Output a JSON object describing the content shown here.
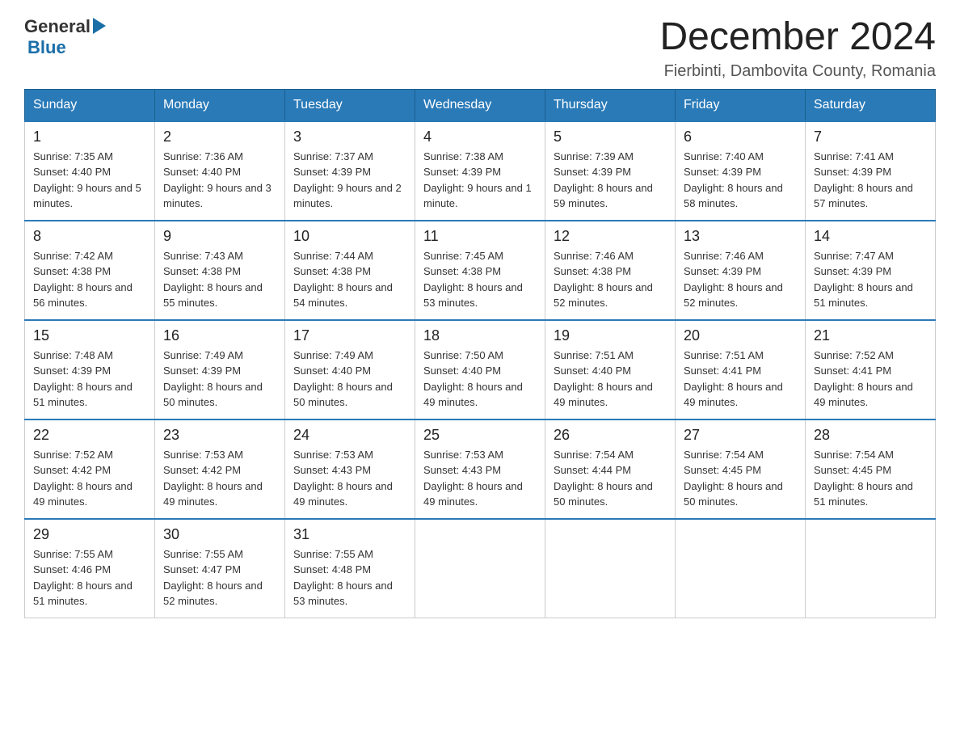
{
  "header": {
    "logo_general": "General",
    "logo_blue": "Blue",
    "month_year": "December 2024",
    "location": "Fierbinti, Dambovita County, Romania"
  },
  "days_of_week": [
    "Sunday",
    "Monday",
    "Tuesday",
    "Wednesday",
    "Thursday",
    "Friday",
    "Saturday"
  ],
  "weeks": [
    [
      {
        "day": "1",
        "sunrise": "7:35 AM",
        "sunset": "4:40 PM",
        "daylight": "9 hours and 5 minutes."
      },
      {
        "day": "2",
        "sunrise": "7:36 AM",
        "sunset": "4:40 PM",
        "daylight": "9 hours and 3 minutes."
      },
      {
        "day": "3",
        "sunrise": "7:37 AM",
        "sunset": "4:39 PM",
        "daylight": "9 hours and 2 minutes."
      },
      {
        "day": "4",
        "sunrise": "7:38 AM",
        "sunset": "4:39 PM",
        "daylight": "9 hours and 1 minute."
      },
      {
        "day": "5",
        "sunrise": "7:39 AM",
        "sunset": "4:39 PM",
        "daylight": "8 hours and 59 minutes."
      },
      {
        "day": "6",
        "sunrise": "7:40 AM",
        "sunset": "4:39 PM",
        "daylight": "8 hours and 58 minutes."
      },
      {
        "day": "7",
        "sunrise": "7:41 AM",
        "sunset": "4:39 PM",
        "daylight": "8 hours and 57 minutes."
      }
    ],
    [
      {
        "day": "8",
        "sunrise": "7:42 AM",
        "sunset": "4:38 PM",
        "daylight": "8 hours and 56 minutes."
      },
      {
        "day": "9",
        "sunrise": "7:43 AM",
        "sunset": "4:38 PM",
        "daylight": "8 hours and 55 minutes."
      },
      {
        "day": "10",
        "sunrise": "7:44 AM",
        "sunset": "4:38 PM",
        "daylight": "8 hours and 54 minutes."
      },
      {
        "day": "11",
        "sunrise": "7:45 AM",
        "sunset": "4:38 PM",
        "daylight": "8 hours and 53 minutes."
      },
      {
        "day": "12",
        "sunrise": "7:46 AM",
        "sunset": "4:38 PM",
        "daylight": "8 hours and 52 minutes."
      },
      {
        "day": "13",
        "sunrise": "7:46 AM",
        "sunset": "4:39 PM",
        "daylight": "8 hours and 52 minutes."
      },
      {
        "day": "14",
        "sunrise": "7:47 AM",
        "sunset": "4:39 PM",
        "daylight": "8 hours and 51 minutes."
      }
    ],
    [
      {
        "day": "15",
        "sunrise": "7:48 AM",
        "sunset": "4:39 PM",
        "daylight": "8 hours and 51 minutes."
      },
      {
        "day": "16",
        "sunrise": "7:49 AM",
        "sunset": "4:39 PM",
        "daylight": "8 hours and 50 minutes."
      },
      {
        "day": "17",
        "sunrise": "7:49 AM",
        "sunset": "4:40 PM",
        "daylight": "8 hours and 50 minutes."
      },
      {
        "day": "18",
        "sunrise": "7:50 AM",
        "sunset": "4:40 PM",
        "daylight": "8 hours and 49 minutes."
      },
      {
        "day": "19",
        "sunrise": "7:51 AM",
        "sunset": "4:40 PM",
        "daylight": "8 hours and 49 minutes."
      },
      {
        "day": "20",
        "sunrise": "7:51 AM",
        "sunset": "4:41 PM",
        "daylight": "8 hours and 49 minutes."
      },
      {
        "day": "21",
        "sunrise": "7:52 AM",
        "sunset": "4:41 PM",
        "daylight": "8 hours and 49 minutes."
      }
    ],
    [
      {
        "day": "22",
        "sunrise": "7:52 AM",
        "sunset": "4:42 PM",
        "daylight": "8 hours and 49 minutes."
      },
      {
        "day": "23",
        "sunrise": "7:53 AM",
        "sunset": "4:42 PM",
        "daylight": "8 hours and 49 minutes."
      },
      {
        "day": "24",
        "sunrise": "7:53 AM",
        "sunset": "4:43 PM",
        "daylight": "8 hours and 49 minutes."
      },
      {
        "day": "25",
        "sunrise": "7:53 AM",
        "sunset": "4:43 PM",
        "daylight": "8 hours and 49 minutes."
      },
      {
        "day": "26",
        "sunrise": "7:54 AM",
        "sunset": "4:44 PM",
        "daylight": "8 hours and 50 minutes."
      },
      {
        "day": "27",
        "sunrise": "7:54 AM",
        "sunset": "4:45 PM",
        "daylight": "8 hours and 50 minutes."
      },
      {
        "day": "28",
        "sunrise": "7:54 AM",
        "sunset": "4:45 PM",
        "daylight": "8 hours and 51 minutes."
      }
    ],
    [
      {
        "day": "29",
        "sunrise": "7:55 AM",
        "sunset": "4:46 PM",
        "daylight": "8 hours and 51 minutes."
      },
      {
        "day": "30",
        "sunrise": "7:55 AM",
        "sunset": "4:47 PM",
        "daylight": "8 hours and 52 minutes."
      },
      {
        "day": "31",
        "sunrise": "7:55 AM",
        "sunset": "4:48 PM",
        "daylight": "8 hours and 53 minutes."
      },
      null,
      null,
      null,
      null
    ]
  ]
}
